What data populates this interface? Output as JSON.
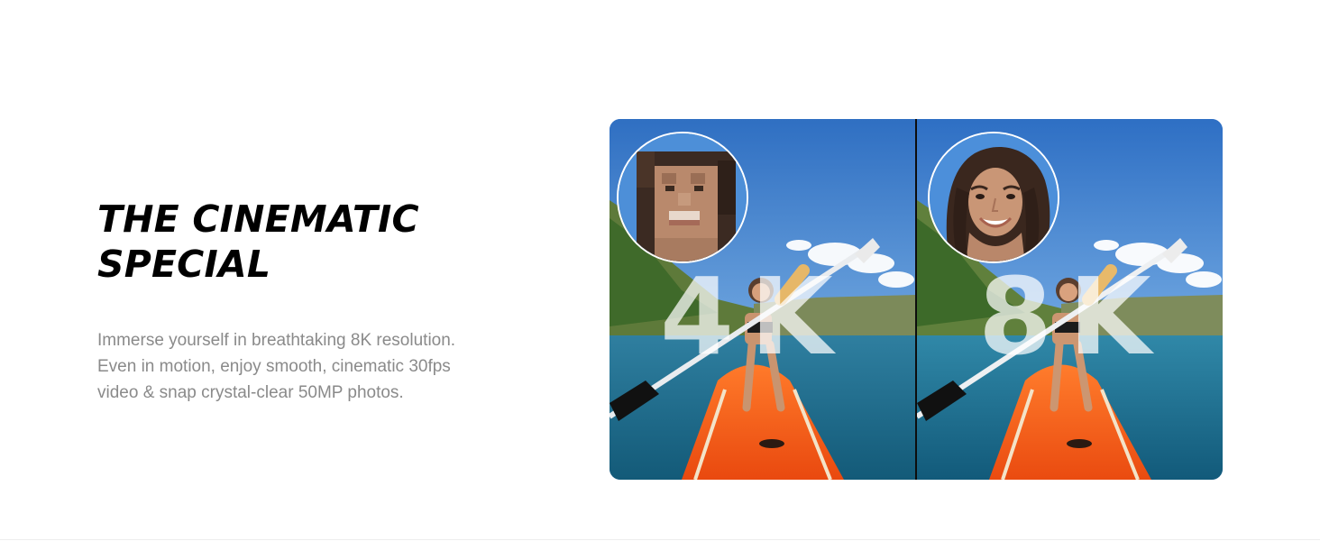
{
  "section": {
    "headline_line1": "THE CINEMATIC",
    "headline_line2": "SPECIAL",
    "body_line1": "Immerse yourself in breathtaking 8K resolution.",
    "body_line2": "Even in motion, enjoy smooth, cinematic 30fps",
    "body_line3": "video & snap crystal-clear 50MP photos."
  },
  "comparison": {
    "left_label": "4K",
    "right_label": "8K"
  }
}
